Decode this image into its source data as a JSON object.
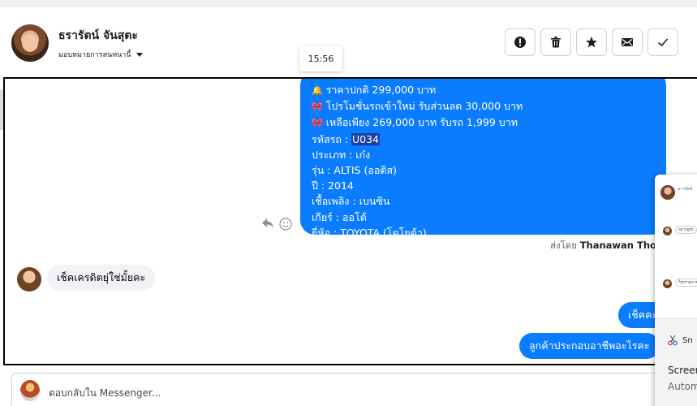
{
  "header": {
    "contact_name": "ธรารัตน์ จันสุตะ",
    "assign_label": "มอบหมายการสนทนานี้",
    "actions": [
      {
        "icon": "exclamation-icon",
        "label": "!"
      },
      {
        "icon": "trash-icon",
        "label": "delete"
      },
      {
        "icon": "star-icon",
        "label": "star"
      },
      {
        "icon": "mail-icon",
        "label": "mail"
      },
      {
        "icon": "check-icon",
        "label": "done"
      }
    ]
  },
  "tooltip": {
    "time": "15:56"
  },
  "messages": {
    "car_info": {
      "lines": [
        {
          "emoji": "🔔",
          "text": "ราคาปกติ 299,000 บาท"
        },
        {
          "emoji": "🎀",
          "text": "โปรโมชั่นรถเข้าใหม่ รับส่วนลด 30,000 บาท"
        },
        {
          "emoji": "🎀",
          "text": "เหลือเพียง 269,000 บาท รับรถ 1,999 บาท"
        },
        {
          "emoji": "",
          "text": "รหัสรถ : ",
          "highlight": "U034"
        },
        {
          "emoji": "",
          "text": "ประเภท : เก๋ง"
        },
        {
          "emoji": "",
          "text": "รุ่น : ALTIS (ออติส)"
        },
        {
          "emoji": "",
          "text": "ปี : 2014"
        },
        {
          "emoji": "",
          "text": "เชื้อเพลิง : เบนซิน"
        },
        {
          "emoji": "",
          "text": "เกียร์ : ออโต้"
        },
        {
          "emoji": "",
          "text": "ยี่ห้อ : TOYOTA (โตโยต้า)"
        }
      ],
      "sent_by_label": "ส่งโดย",
      "sent_by_name": "Thanawan Thon"
    },
    "customer_msg": "เช็คเครดิตยุ่ใช่มั้ยคะ",
    "agent_msg_1": "เช็คคะ",
    "agent_msg_2": "ลูกค้าประกอบอาชีพอะไรคะ"
  },
  "reply": {
    "placeholder": "ตอบกลับใน Messenger..."
  },
  "side_panel": {
    "top_name": "นาารัตน์",
    "pill_1": "อยากดูรถ",
    "pill_2": "ก็รถรายการ",
    "snip_label": "Sn",
    "screen_label": "Screen",
    "auto_label": "Autom"
  },
  "colors": {
    "messenger_blue": "#0a7cff",
    "highlight": "#1c3ea7",
    "gray_bubble": "#f0f2f5"
  }
}
